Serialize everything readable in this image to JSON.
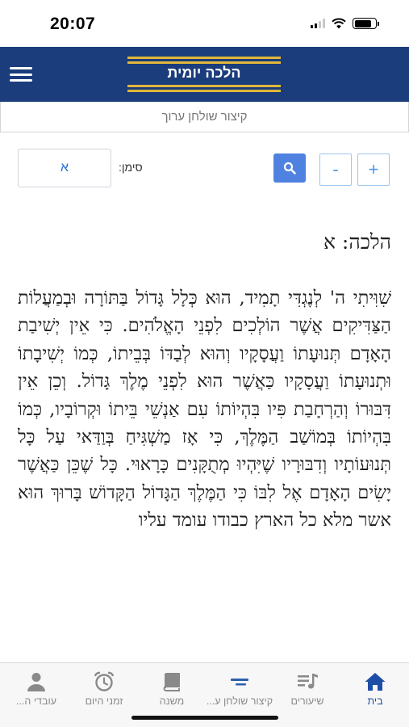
{
  "status_bar": {
    "time": "20:07"
  },
  "header": {
    "app_title": "הלכה יומית"
  },
  "book": {
    "title": "קיצור שולחן ערוך"
  },
  "controls": {
    "siman_label": "סימן:",
    "siman_value": "א",
    "minus_label": "-",
    "plus_label": "+"
  },
  "content": {
    "halacha_title": "הלכה: א",
    "halacha_text": "שִׁוִּיתִי ה' לְנֶגְדִּי תָמִיד, הוּא כְּלָל גָּדוֹל בַּתּוֹרָה וּבְמַעֲלוֹת הַצַּדִּיקִים אֲשֶׁר הוֹלְכִים לִפְנֵי הָאֱלֹהִים. כִּי אֵין יְשִׁיבַת הָאָדָם תְּנוּעָתוֹ וַעֲסָקָיו וְהוּא לְבַדּוֹ בְּבֵיתוֹ, כְּמוֹ יְשִׁיבָתוֹ וּתְנוּעָתוֹ וַעֲסָקָיו כַּאֲשֶׁר הוּא לִפְנֵי מֶלֶךְ גָּדוֹל. וְכֵן אֵין דִּבּוּרוֹ וְהַרְחָבַת פִּיו בִּהְיוֹתוֹ עִם אַנְשֵׁי בֵּיתוֹ וּקְרוֹבָיו, כְּמוֹ בִּהְיוֹתוֹ בְּמוֹשַׁב הַמֶּלֶךְ, כִּי אָז מַשְׁגִּיחַ בְּוַדַּאי עַל כָּל תְּנוּעוֹתָיו וְדִבּוּרָיו שֶׁיִּהְיוּ מְתֻקָּנִים כָּרָאוּי. כָּל שֶׁכֵּן כַּאֲשֶׁר יָשִׂים הָאָדָם אֶל לִבּוֹ כִּי הַמֶּלֶךְ הַגָּדוֹל הַקָּדוֹשׁ בָּרוּךְ הוּא אשר מלא כל הארץ כבודו עומד עליו"
  },
  "tabs": [
    {
      "label": "בית",
      "icon": "home-icon",
      "active": true
    },
    {
      "label": "שיעורים",
      "icon": "music-list-icon",
      "active": false
    },
    {
      "label": "קיצור שולחן ע...",
      "icon": "lines-icon",
      "active": false
    },
    {
      "label": "משנה",
      "icon": "book-icon",
      "active": false
    },
    {
      "label": "זמני היום",
      "icon": "alarm-clock-icon",
      "active": false
    },
    {
      "label": "עובדי ה...",
      "icon": "person-icon",
      "active": false
    }
  ],
  "colors": {
    "header_bg": "#1b3d7c",
    "logo_gold": "#e0b73a",
    "search_button": "#4f82e0",
    "stepper_border": "#9ec5ee",
    "active_tab": "#1d4fa8",
    "inactive_tab": "#8a8a8a"
  }
}
